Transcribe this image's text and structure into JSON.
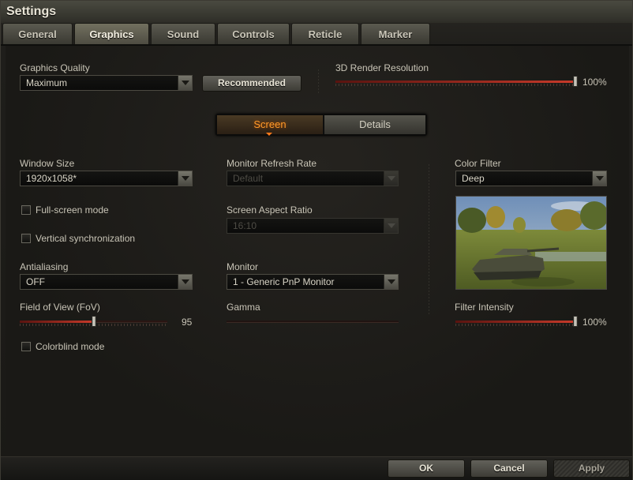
{
  "window": {
    "title": "Settings"
  },
  "tabs": [
    {
      "label": "General"
    },
    {
      "label": "Graphics"
    },
    {
      "label": "Sound"
    },
    {
      "label": "Controls"
    },
    {
      "label": "Reticle"
    },
    {
      "label": "Marker"
    }
  ],
  "active_tab": "Graphics",
  "quality": {
    "label": "Graphics Quality",
    "value": "Maximum",
    "recommended_label": "Recommended"
  },
  "render_resolution": {
    "label": "3D Render Resolution",
    "value_text": "100%",
    "value": 100
  },
  "view_toggle": {
    "screen_label": "Screen",
    "details_label": "Details",
    "active": "Screen"
  },
  "window_size": {
    "label": "Window Size",
    "value": "1920x1058*"
  },
  "fullscreen": {
    "label": "Full-screen mode",
    "checked": false
  },
  "vsync": {
    "label": "Vertical synchronization",
    "checked": false
  },
  "antialiasing": {
    "label": "Antialiasing",
    "value": "OFF"
  },
  "fov": {
    "label": "Field of View (FoV)",
    "value_text": "95",
    "fraction": 0.5
  },
  "colorblind": {
    "label": "Colorblind mode",
    "checked": false
  },
  "refresh_rate": {
    "label": "Monitor Refresh Rate",
    "value": "Default",
    "disabled": true
  },
  "aspect_ratio": {
    "label": "Screen Aspect Ratio",
    "value": "16:10",
    "disabled": true
  },
  "monitor": {
    "label": "Monitor",
    "value": "1 - Generic PnP Monitor"
  },
  "gamma": {
    "label": "Gamma",
    "disabled": true
  },
  "color_filter": {
    "label": "Color Filter",
    "value": "Deep"
  },
  "filter_intensity": {
    "label": "Filter Intensity",
    "value_text": "100%",
    "value": 100
  },
  "footer": {
    "ok_label": "OK",
    "cancel_label": "Cancel",
    "apply_label": "Apply"
  },
  "colors": {
    "accent_orange": "#ff9a2a",
    "slider_red": "#c83a2a",
    "background": "#1b1a17"
  }
}
